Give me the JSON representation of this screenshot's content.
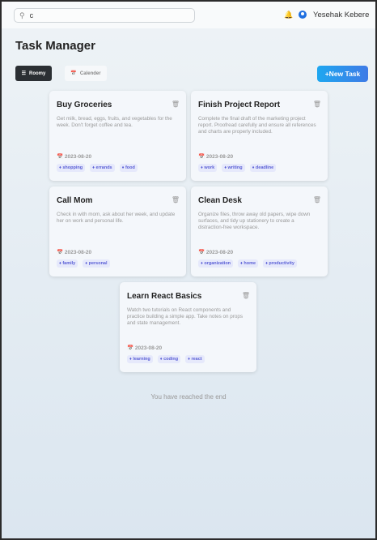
{
  "header": {
    "search_value": "c",
    "user_name": "Yesehak Kebere"
  },
  "page_title": "Task Manager",
  "toolbar": {
    "roomy": "Roomy",
    "calendar": "Calender",
    "new_task": "+New Task"
  },
  "tasks": [
    {
      "title": "Buy Groceries",
      "desc": "Get milk, bread, eggs, fruits, and vegetables for the week. Don't forget coffee and tea.",
      "date": "2023-08-20",
      "tags": [
        "shopping",
        "errands",
        "food"
      ]
    },
    {
      "title": "Finish Project Report",
      "desc": "Complete the final draft of the marketing project report. Proofread carefully and ensure all references and charts are properly included.",
      "date": "2023-08-20",
      "tags": [
        "work",
        "writing",
        "deadline"
      ]
    },
    {
      "title": "Call Mom",
      "desc": "Check in with mom, ask about her week, and update her on work and personal life.",
      "date": "2023-08-20",
      "tags": [
        "family",
        "personal"
      ]
    },
    {
      "title": "Clean Desk",
      "desc": "Organize files, throw away old papers, wipe down surfaces, and tidy up stationery to create a distraction-free workspace.",
      "date": "2023-08-20",
      "tags": [
        "organization",
        "home",
        "productivity"
      ]
    },
    {
      "title": "Learn React Basics",
      "desc": "Watch two tutorials on React components and practice building a simple app. Take notes on props and state management.",
      "date": "2023-08-20",
      "tags": [
        "learning",
        "coding",
        "react"
      ]
    }
  ],
  "end_text": "You have reached the end"
}
